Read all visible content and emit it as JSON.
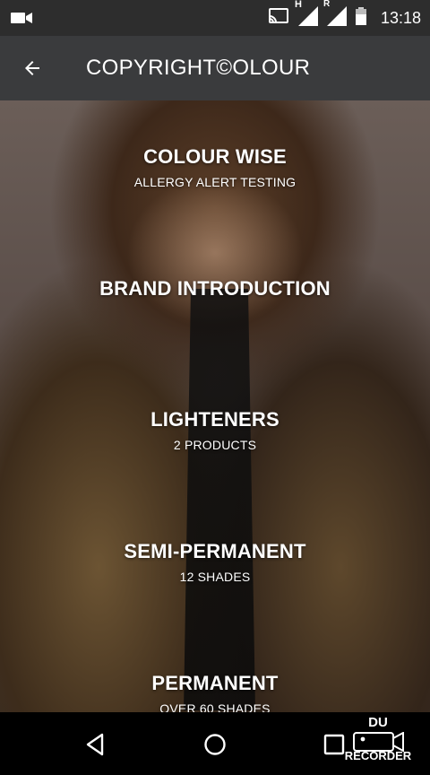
{
  "status_bar": {
    "time": "13:18",
    "network_h": "H",
    "network_r": "R",
    "icons": [
      "video-icon",
      "cast-icon",
      "signal-icon",
      "signal-roaming-icon",
      "battery-icon"
    ]
  },
  "app_bar": {
    "title": "COPYRIGHT©OLOUR",
    "back_icon": "arrow-back-icon"
  },
  "menu": [
    {
      "title": "COLOUR WISE",
      "subtitle": "ALLERGY ALERT TESTING"
    },
    {
      "title": "BRAND INTRODUCTION",
      "subtitle": ""
    },
    {
      "title": "LIGHTENERS",
      "subtitle": "2 PRODUCTS"
    },
    {
      "title": "SEMI-PERMANENT",
      "subtitle": "12 SHADES"
    },
    {
      "title": "PERMANENT",
      "subtitle": "OVER 60 SHADES"
    }
  ],
  "nav_bar": {
    "icons": [
      "back-triangle-icon",
      "home-circle-icon",
      "recents-square-icon"
    ]
  },
  "overlay": {
    "du_label": "DU",
    "recorder_label": "RECORDER"
  }
}
